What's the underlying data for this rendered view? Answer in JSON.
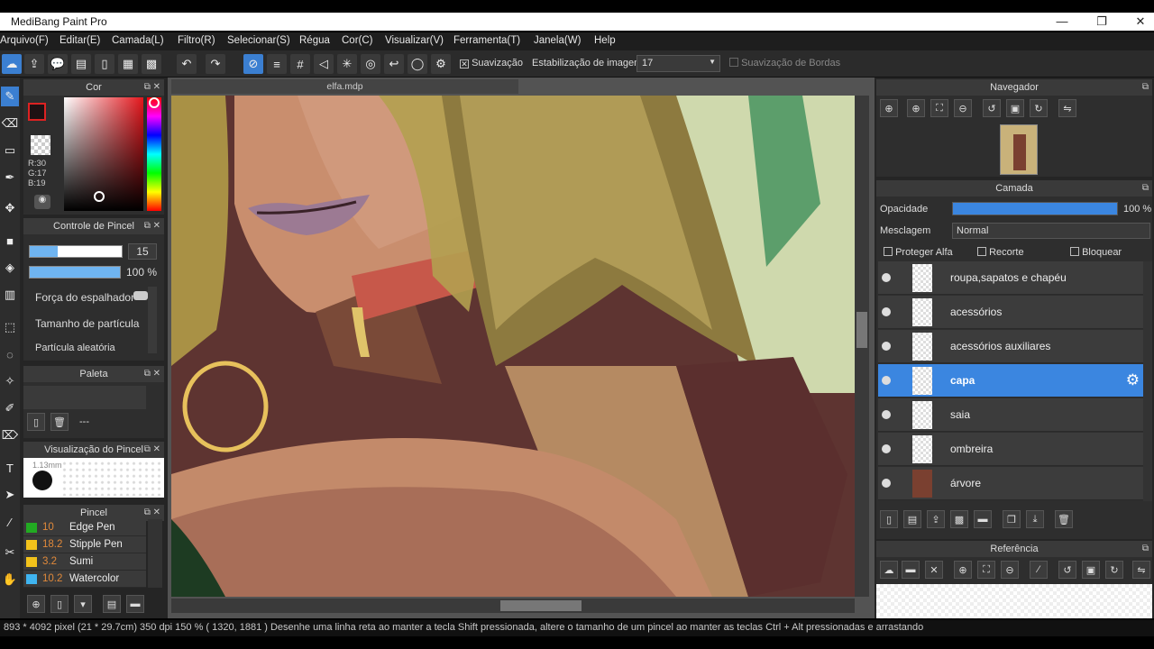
{
  "app": {
    "title": "MediBang Paint Pro",
    "window_controls": [
      "—",
      "❐",
      "✕"
    ]
  },
  "menu": [
    "Arquivo(F)",
    "Editar(E)",
    "Camada(L)",
    "Filtro(R)",
    "Selecionar(S)",
    "Régua",
    "Cor(C)",
    "Visualizar(V)",
    "Ferramenta(T)",
    "Janela(W)",
    "Help"
  ],
  "toolbar": {
    "smoothing_label": "Suavização",
    "stabilization_label": "Estabilização de imagens",
    "stabilization_value": "17",
    "edge_smoothing_label": "Suavização de Bordas"
  },
  "document_tab": "elfa.mdp",
  "color_panel": {
    "title": "Cor",
    "r": "R:30",
    "g": "G:17",
    "b": "B:19",
    "primary_color": "#1e1113"
  },
  "brush_control": {
    "title": "Controle de Pincel",
    "size": "15",
    "opacity": "100 %",
    "params": [
      "Força do espalhador",
      "Tamanho de partícula",
      "Partícula aleatória"
    ]
  },
  "palette": {
    "title": "Paleta",
    "empty_label": "---"
  },
  "brush_preview": {
    "title": "Visualização do Pincel",
    "size_label": "1.13mm"
  },
  "brush_list": {
    "title": "Pincel",
    "items": [
      {
        "size": "10",
        "name": "Edge Pen",
        "color": "#22aa22"
      },
      {
        "size": "18.2",
        "name": "Stipple Pen",
        "color": "#f2c21b"
      },
      {
        "size": "3.2",
        "name": "Sumi",
        "color": "#f2c21b"
      },
      {
        "size": "10.2",
        "name": "Watercolor",
        "color": "#3fb4f0"
      }
    ]
  },
  "navigator": {
    "title": "Navegador"
  },
  "layer_panel": {
    "title": "Camada",
    "opacity_label": "Opacidade",
    "opacity_value": "100 %",
    "opacity_fraction": 1.0,
    "blend_label": "Mesclagem",
    "blend_value": "Normal",
    "protect_alpha": "Proteger Alfa",
    "clipping": "Recorte",
    "lock": "Bloquear",
    "layers": [
      "roupa,sapatos e chapéu",
      "acessórios",
      "acessórios auxiliares",
      "capa",
      "saia",
      "ombreira",
      "árvore"
    ],
    "selected": "capa"
  },
  "reference": {
    "title": "Referência"
  },
  "status_bar": "893 * 4092 pixel  (21 * 29.7cm)  350 dpi  150 %  ( 1320, 1881 )  Desenhe uma linha reta ao manter a tecla Shift pressionada, altere o tamanho de um pincel ao manter as teclas Ctrl + Alt pressionadas e arrastando"
}
